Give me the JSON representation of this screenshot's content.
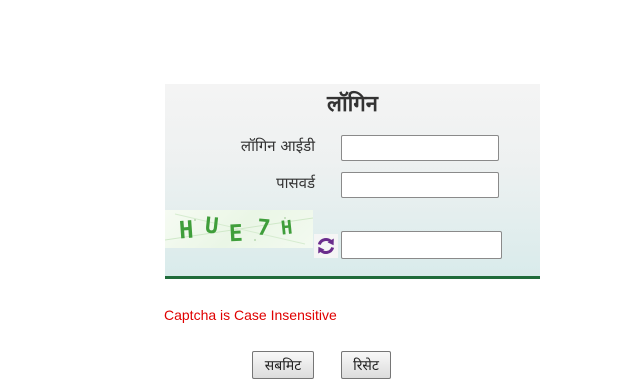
{
  "login": {
    "title": "लॉगिन",
    "login_id_label": "लॉगिन आईडी",
    "password_label": "पासवर्ड",
    "login_id_value": "",
    "password_value": "",
    "captcha_value": ""
  },
  "captcha": {
    "text": "HUE7H",
    "chars": [
      "H",
      "U",
      "E",
      "7",
      "H"
    ],
    "hint": "Captcha is Case Insensitive",
    "refresh_icon": "refresh-icon"
  },
  "buttons": {
    "submit_label": "सबमिट",
    "reset_label": "रिसेट"
  },
  "colors": {
    "accent_border": "#1f6b3a",
    "hint_text": "#e00000",
    "captcha_text": "#3f9e3b",
    "refresh_icon": "#6a2c8c"
  }
}
